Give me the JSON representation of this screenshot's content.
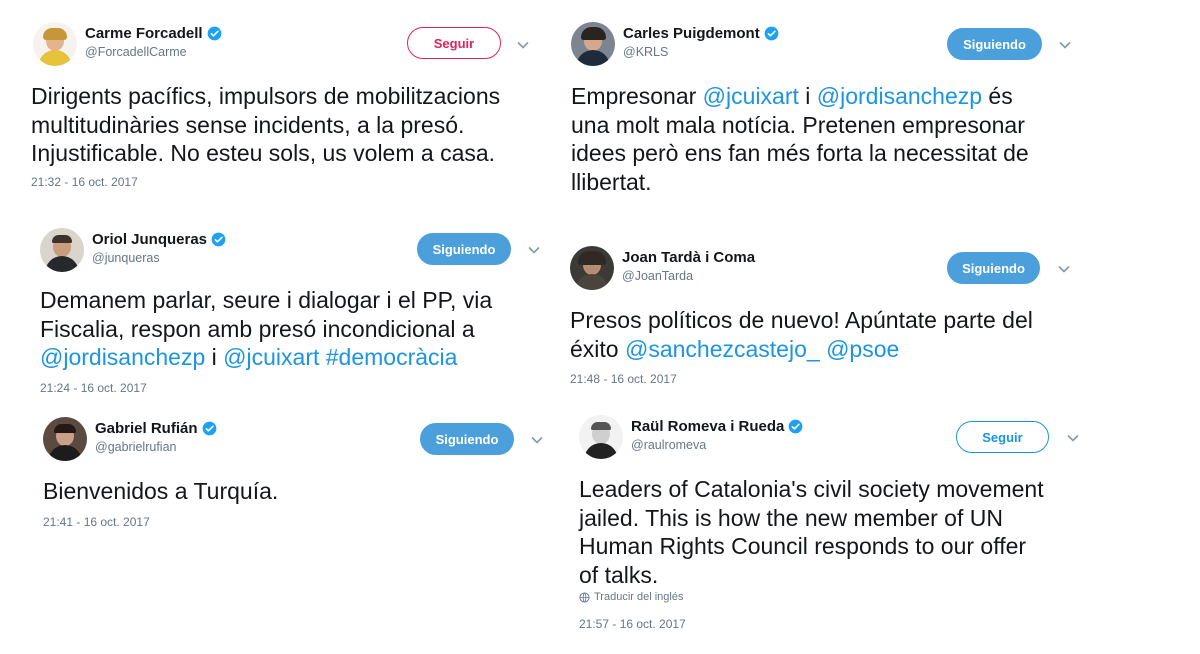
{
  "tweets": [
    {
      "name": "Carme Forcadell",
      "handle": "@ForcadellCarme",
      "button": "Seguir",
      "text_lines": [
        [
          {
            "t": "Dirigents pacífics, impulsors de mobilitzacions"
          }
        ],
        [
          {
            "t": "multitudinàries sense incidents, a la presó."
          }
        ],
        [
          {
            "t": "Injustificable. No esteu sols, us volem a casa."
          }
        ]
      ],
      "time": "21:32 - 16 oct. 2017"
    },
    {
      "name": "Oriol Junqueras",
      "handle": "@junqueras",
      "button": "Siguiendo",
      "text_lines": [
        [
          {
            "t": "Demanem parlar, seure i dialogar i el PP, via"
          }
        ],
        [
          {
            "t": "Fiscalia, respon amb presó incondicional a"
          }
        ],
        [
          {
            "t": "@jordisanchezp",
            "l": true
          },
          {
            "t": " i "
          },
          {
            "t": "@jcuixart",
            "l": true
          },
          {
            "t": " "
          },
          {
            "t": "#democràcia",
            "l": true
          }
        ]
      ],
      "time": "21:24 - 16 oct. 2017"
    },
    {
      "name": "Gabriel Rufián",
      "handle": "@gabrielrufian",
      "button": "Siguiendo",
      "text_lines": [
        [
          {
            "t": "Bienvenidos a Turquía."
          }
        ]
      ],
      "time": "21:41 - 16 oct. 2017"
    },
    {
      "name": "Carles Puigdemont",
      "handle": "@KRLS",
      "button": "Siguiendo",
      "text_lines": [
        [
          {
            "t": "Empresonar "
          },
          {
            "t": "@jcuixart",
            "l": true
          },
          {
            "t": " i "
          },
          {
            "t": "@jordisanchezp",
            "l": true
          },
          {
            "t": " és"
          }
        ],
        [
          {
            "t": "una molt mala notícia. Pretenen empresonar"
          }
        ],
        [
          {
            "t": "idees però ens fan més forta la necessitat de"
          }
        ],
        [
          {
            "t": "llibertat."
          }
        ]
      ],
      "time": ""
    },
    {
      "name": "Joan Tardà i Coma",
      "handle": "@JoanTarda",
      "button": "Siguiendo",
      "text_lines": [
        [
          {
            "t": "Presos políticos de nuevo! Apúntate parte del"
          }
        ],
        [
          {
            "t": "éxito "
          },
          {
            "t": "@sanchezcastejo_",
            "l": true
          },
          {
            "t": " "
          },
          {
            "t": "@psoe",
            "l": true
          }
        ]
      ],
      "time": "21:48 - 16 oct. 2017"
    },
    {
      "name": "Raül Romeva i Rueda",
      "handle": "@raulromeva",
      "button": "Seguir",
      "text_lines": [
        [
          {
            "t": "Leaders of Catalonia's civil society movement"
          }
        ],
        [
          {
            "t": "jailed. This is how the new member of UN"
          }
        ],
        [
          {
            "t": "Human Rights Council responds to our offer"
          }
        ],
        [
          {
            "t": "of talks."
          }
        ]
      ],
      "translate": "Traducir del inglés",
      "time": "21:57 - 16 oct. 2017"
    }
  ],
  "colors": {
    "link": "#1b95e0",
    "following_bg": "#4ba0dc",
    "follow_red": "#e0245e",
    "muted": "#657786",
    "verified": "#1da1f2"
  },
  "icons": [
    "verified-badge-icon",
    "chevron-down-icon",
    "globe-icon"
  ]
}
